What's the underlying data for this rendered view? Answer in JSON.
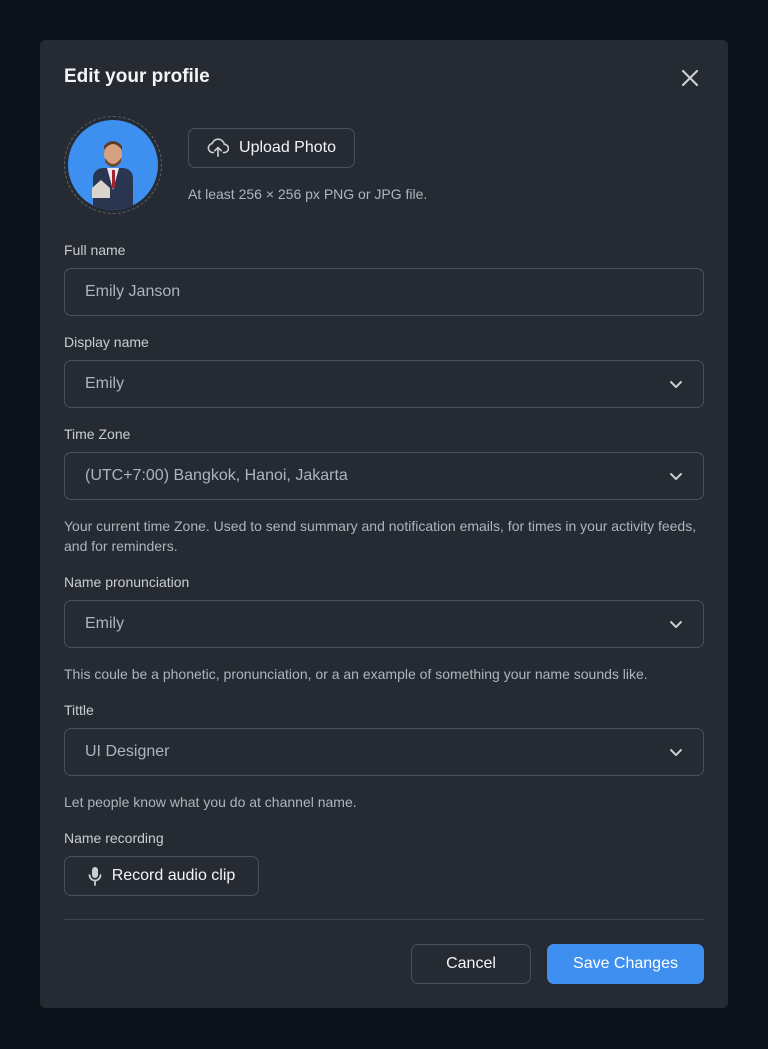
{
  "title": "Edit your profile",
  "upload": {
    "label": "Upload Photo",
    "hint": "At least 256 × 256 px PNG or JPG file."
  },
  "fields": {
    "full_name": {
      "label": "Full name",
      "value": "Emily Janson"
    },
    "display_name": {
      "label": "Display name",
      "value": "Emily"
    },
    "time_zone": {
      "label": "Time Zone",
      "value": "(UTC+7:00) Bangkok, Hanoi, Jakarta",
      "help": "Your current time Zone. Used to send summary and notification emails, for times in your activity feeds, and for reminders."
    },
    "pronunciation": {
      "label": "Name pronunciation",
      "value": "Emily",
      "help": "This coule be a phonetic, pronunciation, or a an example of something your name sounds like."
    },
    "title": {
      "label": "Tittle",
      "value": "UI Designer",
      "help": "Let people know what you do at channel name."
    },
    "recording": {
      "label": "Name recording",
      "button": "Record audio clip"
    }
  },
  "actions": {
    "cancel": "Cancel",
    "save": "Save Changes"
  },
  "colors": {
    "accent": "#3f8ff0",
    "modal": "#262b33",
    "backdrop": "#0e121a"
  }
}
